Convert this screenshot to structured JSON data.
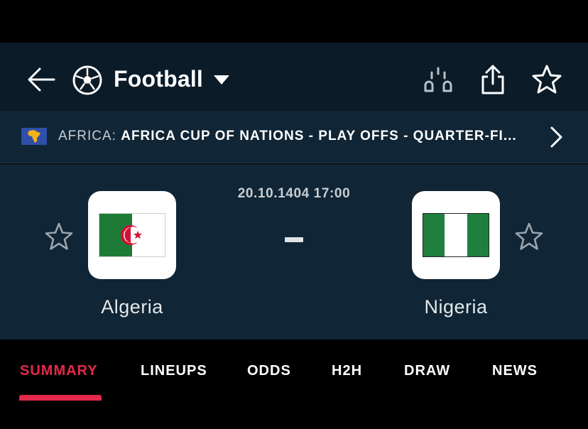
{
  "header": {
    "sport_label": "Football",
    "icons": {
      "back": "arrow-left-icon",
      "sport": "soccer-ball-icon",
      "dropdown": "caret-down-icon",
      "odds": "odds-icon",
      "share": "share-icon",
      "favorite": "star-icon"
    }
  },
  "league": {
    "country": "AFRICA:",
    "name": "AFRICA CUP OF NATIONS - PLAY OFFS - QUARTER-FI..."
  },
  "match": {
    "datetime": "20.10.1404 17:00",
    "home_team": "Algeria",
    "away_team": "Nigeria"
  },
  "tabs": [
    {
      "label": "SUMMARY",
      "active": true
    },
    {
      "label": "LINEUPS",
      "active": false
    },
    {
      "label": "ODDS",
      "active": false
    },
    {
      "label": "H2H",
      "active": false
    },
    {
      "label": "DRAW",
      "active": false
    },
    {
      "label": "NEWS",
      "active": false
    }
  ],
  "colors": {
    "header_bg": "#0b1b27",
    "panel_bg": "#102535",
    "accent": "#e5294b",
    "algeria_green": "#1e7b35",
    "algeria_red": "#d21034",
    "nigeria_green": "#1f7f3e"
  }
}
